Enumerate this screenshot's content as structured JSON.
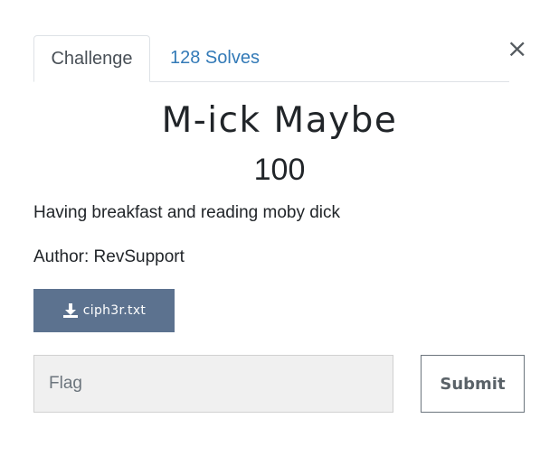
{
  "tabs": {
    "challenge_label": "Challenge",
    "solves_label": "128 Solves"
  },
  "close_glyph": "×",
  "challenge": {
    "name": "M-ick Maybe",
    "value": "100",
    "description": "Having breakfast and reading moby dick",
    "author": "Author: RevSupport"
  },
  "file": {
    "name": "ciph3r.txt",
    "icon": "download-icon"
  },
  "flag_form": {
    "placeholder": "Flag",
    "value": "",
    "submit_label": "Submit"
  },
  "colors": {
    "file_button_bg": "#5c728f",
    "link": "#337ab7",
    "input_bg": "#f0f0f0"
  }
}
